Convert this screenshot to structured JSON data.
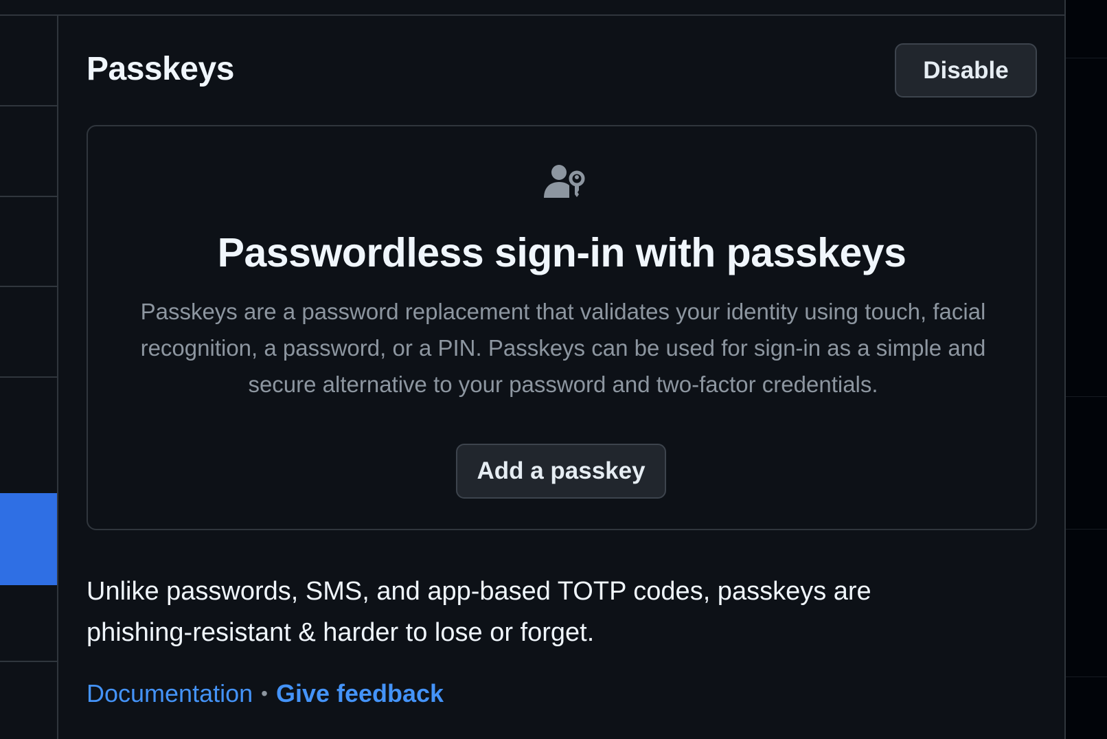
{
  "section": {
    "title": "Passkeys",
    "disable_label": "Disable"
  },
  "blankslate": {
    "icon": "passkey-icon",
    "heading": "Passwordless sign-in with passkeys",
    "description": "Passkeys are a password replacement that validates your identity using touch, facial recognition, a password, or a PIN. Passkeys can be used for sign-in as a simple and secure alternative to your password and two-factor credentials.",
    "add_label": "Add a passkey"
  },
  "explanation": "Unlike passwords, SMS, and app-based TOTP codes, passkeys are phishing-resistant & harder to lose or forget.",
  "links": {
    "documentation": "Documentation",
    "separator": "•",
    "feedback": "Give feedback"
  },
  "colors": {
    "background": "#0d1117",
    "border": "#30363d",
    "accent": "#4493f8",
    "active_nav": "#2f6fe4",
    "muted_text": "#8d96a0"
  }
}
